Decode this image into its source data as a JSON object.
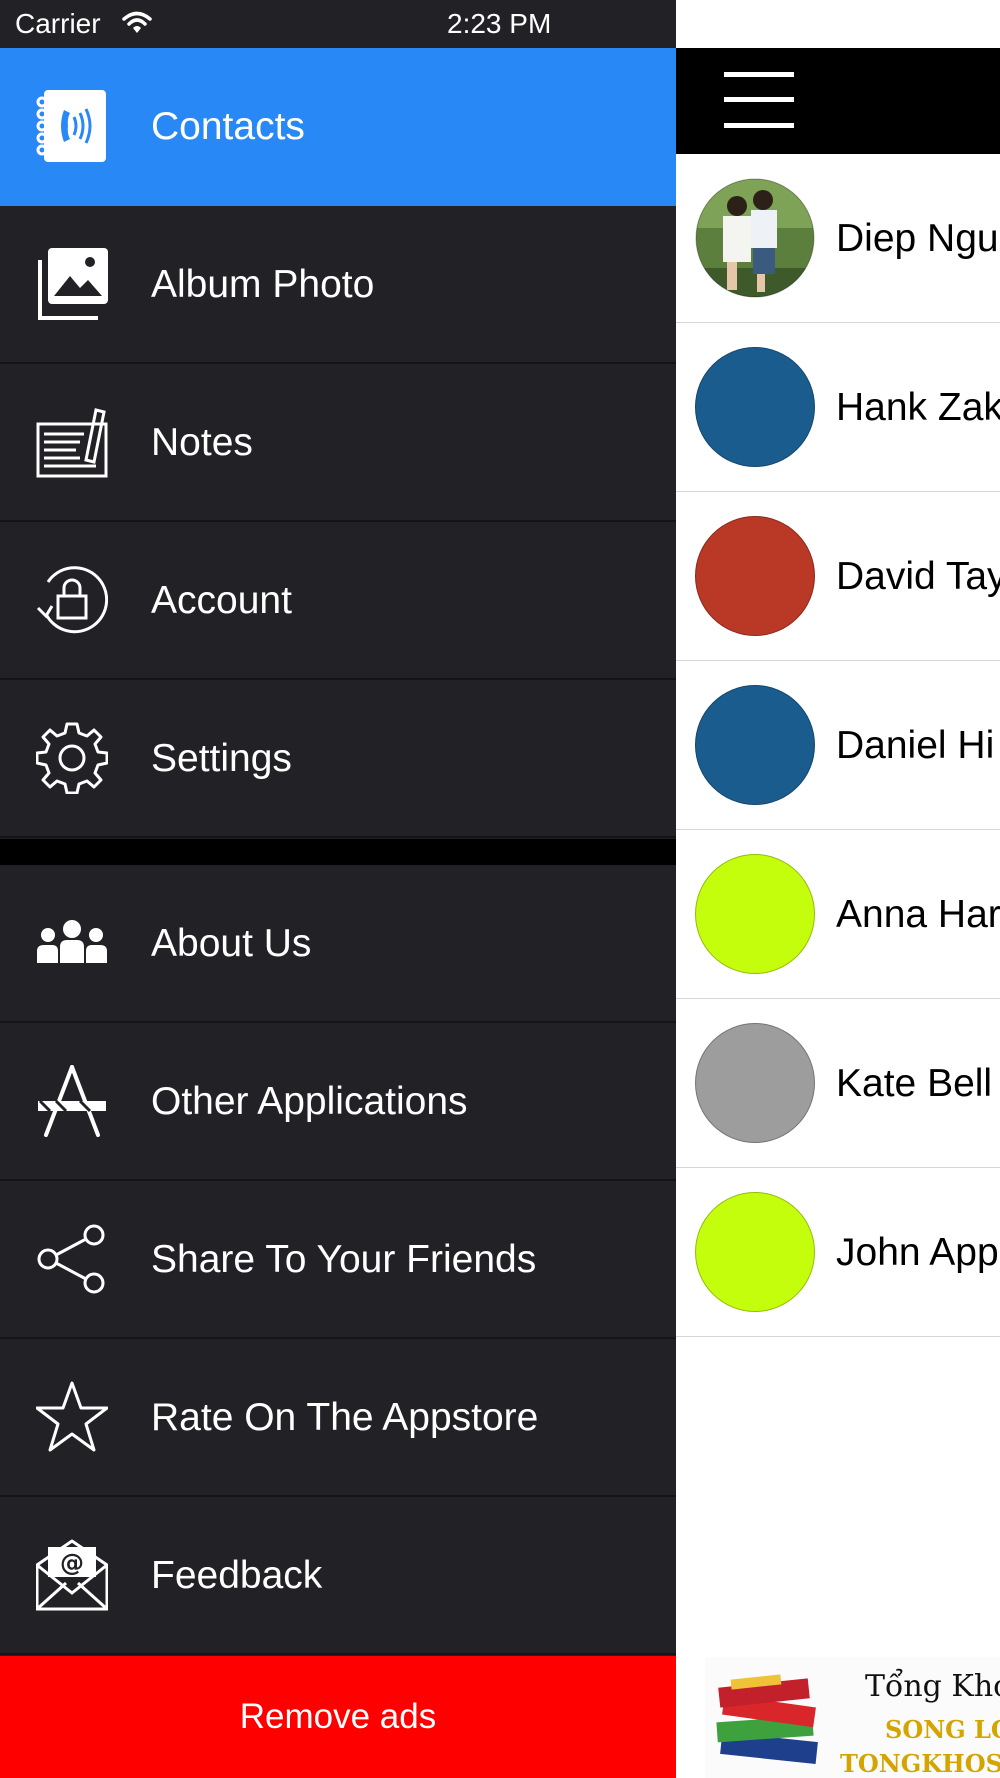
{
  "status_bar": {
    "carrier": "Carrier",
    "time": "2:23 PM",
    "wifi_icon": "wifi-icon",
    "battery_icon": "battery-icon",
    "charging_icon": "bolt-icon",
    "battery_color": "#4cd964"
  },
  "menu": {
    "active_color": "#2889f6",
    "background": "#222126",
    "items": [
      {
        "label": "Contacts",
        "icon": "contacts-book-icon"
      },
      {
        "label": "Album Photo",
        "icon": "photo-album-icon"
      },
      {
        "label": "Notes",
        "icon": "notes-icon"
      },
      {
        "label": "Account",
        "icon": "lock-icon"
      },
      {
        "label": "Settings",
        "icon": "gear-icon"
      },
      {
        "label": "About Us",
        "icon": "people-icon"
      },
      {
        "label": "Other Applications",
        "icon": "app-store-icon"
      },
      {
        "label": "Share To Your Friends",
        "icon": "share-icon"
      },
      {
        "label": "Rate On The Appstore",
        "icon": "star-icon"
      },
      {
        "label": "Feedback",
        "icon": "email-icon"
      }
    ],
    "remove_ads": "Remove ads",
    "remove_ads_color": "#fe0000"
  },
  "nav": {
    "menu_icon": "hamburger-icon"
  },
  "contacts": [
    {
      "name": "Diep Ngu",
      "avatar_color": "#6a8a4a",
      "has_photo": true
    },
    {
      "name": "Hank Zak",
      "avatar_color": "#1b5c8f"
    },
    {
      "name": "David Tay",
      "avatar_color": "#ba3826"
    },
    {
      "name": "Daniel Hi",
      "avatar_color": "#1b5c8f"
    },
    {
      "name": "Anna Har",
      "avatar_color": "#c4fe0c"
    },
    {
      "name": "Kate Bell",
      "avatar_color": "#9d9d9d"
    },
    {
      "name": "John App",
      "avatar_color": "#c4fe0c"
    }
  ],
  "ad": {
    "line1": "Tổng Kho",
    "line2": "SONG LO",
    "line3": "TONGKHOSI"
  }
}
